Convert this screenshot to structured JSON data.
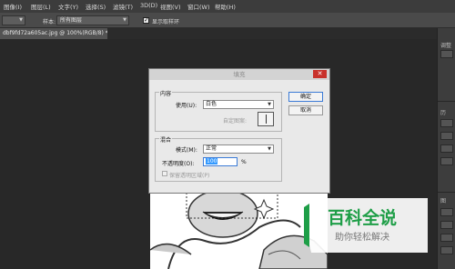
{
  "menubar": {
    "items": [
      "图像(I)",
      "图层(L)",
      "文字(Y)",
      "选择(S)",
      "滤镜(T)",
      "3D(D)",
      "视图(V)",
      "窗口(W)",
      "帮助(H)"
    ]
  },
  "options": {
    "combo1_value": "",
    "sample_label": "样本:",
    "sample_value": "所有图层",
    "show_ring_label": "显示取样环"
  },
  "document": {
    "tab_title": "dbf9fd72a605ac.jpg @ 100%(RGB/8) *"
  },
  "right_panel": {
    "labels": [
      "调整",
      "历",
      "图"
    ]
  },
  "dialog": {
    "title": "填充",
    "close_glyph": "✕",
    "contents_group": "内容",
    "use_label": "使用(U):",
    "use_value": "白色",
    "custom_pattern_label": "自定图案:",
    "blending_group": "混合",
    "mode_label": "模式(M):",
    "mode_value": "正常",
    "opacity_label": "不透明度(O):",
    "opacity_value": "100",
    "opacity_unit": "%",
    "preserve_label": "保留透明区域(P)",
    "ok_label": "确定",
    "cancel_label": "取消"
  },
  "watermark": {
    "title": "百科全说",
    "subtitle": "助你轻松解决"
  }
}
